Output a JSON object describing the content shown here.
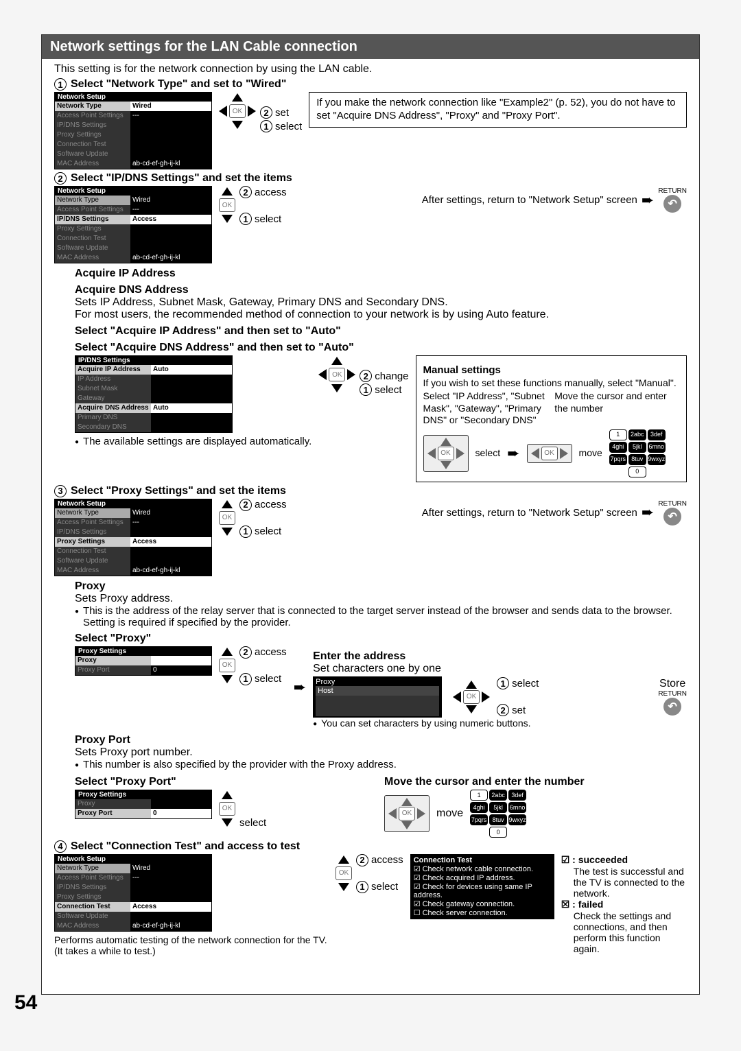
{
  "title": "Network settings for the LAN Cable connection",
  "intro": "This setting is for the network connection by using the LAN cable.",
  "page_number": "54",
  "step1": {
    "title": "Select \"Network Type\" and set to \"Wired\"",
    "menu_title": "Network Setup",
    "rows": {
      "r1l": "Network Type",
      "r1v": "Wired",
      "r2l": "Access Point Settings",
      "r2v": "---",
      "r3l": "IP/DNS Settings",
      "r4l": "Proxy Settings",
      "r5l": "Connection Test",
      "r6l": "Software Update",
      "r7l": "MAC Address",
      "r7v": "ab-cd-ef-gh-ij-kl"
    },
    "lbl_set": "set",
    "lbl_select": "select",
    "note": "If you make the network connection like \"Example2\" (p. 52), you do not have to set \"Acquire DNS Address\", \"Proxy\" and \"Proxy Port\"."
  },
  "step2": {
    "title": "Select \"IP/DNS Settings\" and set the items",
    "menu_title": "Network Setup",
    "rows": {
      "r1l": "Network Type",
      "r1v": "Wired",
      "r2l": "Access Point Settings",
      "r2v": "---",
      "r3l": "IP/DNS Settings",
      "r3v": "Access",
      "r4l": "Proxy Settings",
      "r5l": "Connection Test",
      "r6l": "Software Update",
      "r7l": "MAC Address",
      "r7v": "ab-cd-ef-gh-ij-kl"
    },
    "lbl_access": "access",
    "lbl_select": "select",
    "return_text": "After settings, return to \"Network Setup\" screen",
    "return_label": "RETURN"
  },
  "acquire": {
    "h1": "Acquire IP Address",
    "h2": "Acquire DNS Address",
    "p1": "Sets IP Address, Subnet Mask, Gateway, Primary DNS and Secondary DNS.",
    "p2": "For most users, the recommended method of connection to your network is by using Auto feature.",
    "b1": "Select \"Acquire IP Address\" and then set to \"Auto\"",
    "b2": "Select \"Acquire DNS Address\" and then set to \"Auto\"",
    "menu_title": "IP/DNS Settings",
    "rows": {
      "r1l": "Acquire IP Address",
      "r1v": "Auto",
      "r2l": "IP Address",
      "r3l": "Subnet Mask",
      "r4l": "Gateway",
      "r5l": "Acquire DNS Address",
      "r5v": "Auto",
      "r6l": "Primary DNS",
      "r7l": "Secondary DNS"
    },
    "lbl_change": "change",
    "lbl_select": "select",
    "note1": "The available settings are displayed automatically.",
    "manual_h": "Manual settings",
    "manual_p": "If you wish to set these functions manually, select \"Manual\".",
    "manual_left": "Select \"IP Address\", \"Subnet Mask\", \"Gateway\", \"Primary DNS\" or \"Secondary DNS\"",
    "manual_right": "Move the cursor and enter the number",
    "lbl_move": "move",
    "lbl_select2": "select"
  },
  "step3": {
    "title": "Select \"Proxy Settings\" and set the items",
    "menu_title": "Network Setup",
    "rows": {
      "r1l": "Network Type",
      "r1v": "Wired",
      "r2l": "Access Point Settings",
      "r2v": "---",
      "r3l": "IP/DNS Settings",
      "r4l": "Proxy Settings",
      "r4v": "Access",
      "r5l": "Connection Test",
      "r6l": "Software Update",
      "r7l": "MAC Address",
      "r7v": "ab-cd-ef-gh-ij-kl"
    },
    "lbl_access": "access",
    "lbl_select": "select",
    "return_text": "After settings, return to \"Network Setup\" screen",
    "return_label": "RETURN"
  },
  "proxy": {
    "h": "Proxy",
    "p1": "Sets Proxy address.",
    "p2": "This is the address of the relay server that is connected to the target server instead of the browser and sends data to the browser. Setting is required if specified by the provider.",
    "sel": "Select \"Proxy\"",
    "menu_title": "Proxy Settings",
    "rows": {
      "r1l": "Proxy",
      "r2l": "Proxy Port",
      "r2v": "0"
    },
    "lbl_access": "access",
    "lbl_select": "select",
    "enter_h": "Enter the address",
    "enter_p": "Set characters one by one",
    "proxy_label": "Proxy",
    "host_label": "Host",
    "store": "Store",
    "return_label": "RETURN",
    "lbl_set": "set",
    "lbl_select2": "select",
    "note": "You can set characters by using numeric buttons."
  },
  "proxyport": {
    "h": "Proxy Port",
    "p1": "Sets Proxy port number.",
    "p2": "This number is also specified by the provider with the Proxy address.",
    "sel": "Select \"Proxy Port\"",
    "menu_title": "Proxy Settings",
    "rows": {
      "r1l": "Proxy",
      "r2l": "Proxy Port",
      "r2v": "0"
    },
    "lbl_select": "select",
    "move_h": "Move the cursor and enter the number",
    "lbl_move": "move"
  },
  "step4": {
    "title": "Select \"Connection Test\" and access to test",
    "menu_title": "Network Setup",
    "rows": {
      "r1l": "Network Type",
      "r1v": "Wired",
      "r2l": "Access Point Settings",
      "r2v": "---",
      "r3l": "IP/DNS Settings",
      "r4l": "Proxy Settings",
      "r5l": "Connection Test",
      "r5v": "Access",
      "r6l": "Software Update",
      "r7l": "MAC Address",
      "r7v": "ab-cd-ef-gh-ij-kl"
    },
    "lbl_access": "access",
    "lbl_select": "select",
    "conn_title": "Connection Test",
    "c1": "Check network cable connection.",
    "c2": "Check acquired IP address.",
    "c3": "Check for devices using same IP address.",
    "c4": "Check gateway connection.",
    "c5": "Check server connection.",
    "performs": "Performs automatic testing of the network connection for the TV. (It takes a while to test.)",
    "succ_l": ": succeeded",
    "succ_d": "The test is successful and the TV is connected to the network.",
    "fail_l": ": failed",
    "fail_d": "Check the settings and connections, and then perform this function again."
  },
  "keys": {
    "k1": "1",
    "k2": "2abc",
    "k3": "3def",
    "k4": "4ghi",
    "k5": "5jkl",
    "k6": "6mno",
    "k7": "7pqrs",
    "k8": "8tuv",
    "k9": "9wxyz",
    "k0": "0"
  }
}
